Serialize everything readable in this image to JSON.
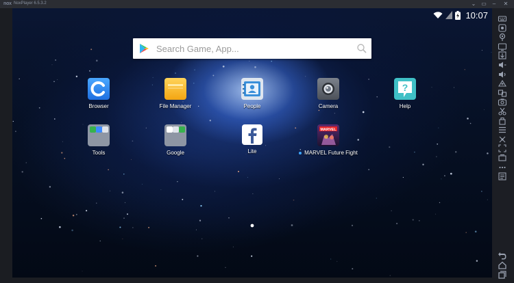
{
  "window": {
    "logo": "nox",
    "title": "NoxPlayer 6.5.3.2",
    "controls": [
      "chevron-down-icon",
      "restore-icon",
      "minimize-icon",
      "close-icon"
    ]
  },
  "statusbar": {
    "time": "10:07",
    "icons": [
      "wifi-icon",
      "signal-icon",
      "battery-charging-icon"
    ]
  },
  "search": {
    "placeholder": "Search Game, App...",
    "value": ""
  },
  "apps": [
    {
      "id": "browser",
      "label": "Browser",
      "icon": "browser-icon"
    },
    {
      "id": "file-manager",
      "label": "File Manager",
      "icon": "folder-icon"
    },
    {
      "id": "people",
      "label": "People",
      "icon": "contacts-icon"
    },
    {
      "id": "camera",
      "label": "Camera",
      "icon": "camera-icon"
    },
    {
      "id": "help",
      "label": "Help",
      "icon": "help-icon"
    },
    {
      "id": "tools",
      "label": "Tools",
      "icon": "tools-folder-icon"
    },
    {
      "id": "google",
      "label": "Google",
      "icon": "google-folder-icon"
    },
    {
      "id": "lite",
      "label": "Lite",
      "icon": "facebook-icon"
    },
    {
      "id": "marvel",
      "label": "MARVEL Future Fight",
      "icon": "marvel-icon",
      "badge": "new-install-dot"
    }
  ],
  "sidebar_tools": [
    "keyboard-icon",
    "macro-icon",
    "location-icon",
    "screen-record-icon",
    "import-icon",
    "volume-down-icon",
    "volume-up-icon",
    "add-apk-icon",
    "multi-instance-icon",
    "screenshot-icon",
    "cut-icon",
    "rotate-icon",
    "menu-icon",
    "shake-icon",
    "fullscreen-icon",
    "zoom-icon",
    "more-icon",
    "settings-icon"
  ],
  "nav": [
    "back-icon",
    "home-icon",
    "recent-apps-icon"
  ],
  "colors": {
    "titlebar": "#2b2d33",
    "sidebar": "#1c1e24",
    "search_bg": "#ffffff",
    "accent_blue": "#3d8bff"
  }
}
